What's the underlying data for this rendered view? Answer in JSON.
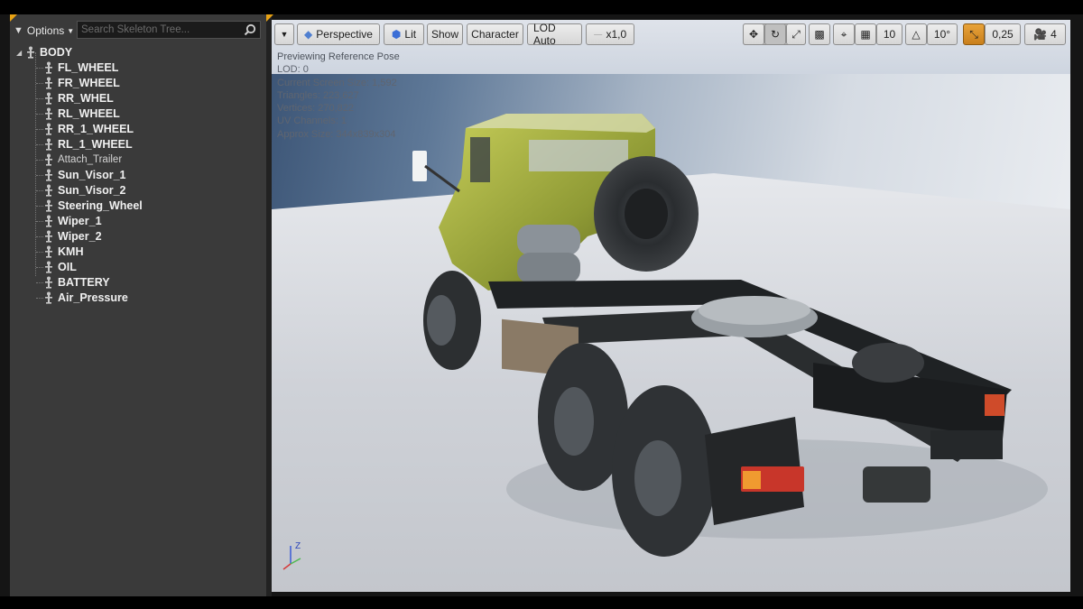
{
  "skeleton_tree": {
    "options_label": "Options",
    "search_placeholder": "Search Skeleton Tree...",
    "root": "BODY",
    "bones": [
      {
        "label": "FL_WHEEL",
        "bold": true
      },
      {
        "label": "FR_WHEEL",
        "bold": true
      },
      {
        "label": "RR_WHEL",
        "bold": true
      },
      {
        "label": "RL_WHEEL",
        "bold": true
      },
      {
        "label": "RR_1_WHEEL",
        "bold": true
      },
      {
        "label": "RL_1_WHEEL",
        "bold": true
      },
      {
        "label": "Attach_Trailer",
        "bold": false
      },
      {
        "label": "Sun_Visor_1",
        "bold": true
      },
      {
        "label": "Sun_Visor_2",
        "bold": true
      },
      {
        "label": "Steering_Wheel",
        "bold": true
      },
      {
        "label": "Wiper_1",
        "bold": true
      },
      {
        "label": "Wiper_2",
        "bold": true
      },
      {
        "label": "KMH",
        "bold": true
      },
      {
        "label": "OIL",
        "bold": true
      },
      {
        "label": "BATTERY",
        "bold": true
      },
      {
        "label": "Air_Pressure",
        "bold": true
      }
    ]
  },
  "viewport_toolbar": {
    "perspective": "Perspective",
    "lit": "Lit",
    "show": "Show",
    "character": "Character",
    "lod": "LOD Auto",
    "speed": "x1,0",
    "grid_snap": "10",
    "rotation_snap": "10°",
    "scale_snap": "0,25",
    "camera_speed": "4"
  },
  "viewport_stats": {
    "lines": [
      "Previewing Reference Pose",
      "LOD: 0",
      "Current Screen Size: 1,592",
      "Triangles: 223,627",
      "Vertices: 270,822",
      "UV Channels: 1",
      "Approx Size: 344x839x304"
    ]
  },
  "axis_labels": {
    "z": "Z"
  },
  "colors": {
    "accent": "#e8a214",
    "panel": "#3a3a3a",
    "truck_cab": "#a8b03c"
  }
}
